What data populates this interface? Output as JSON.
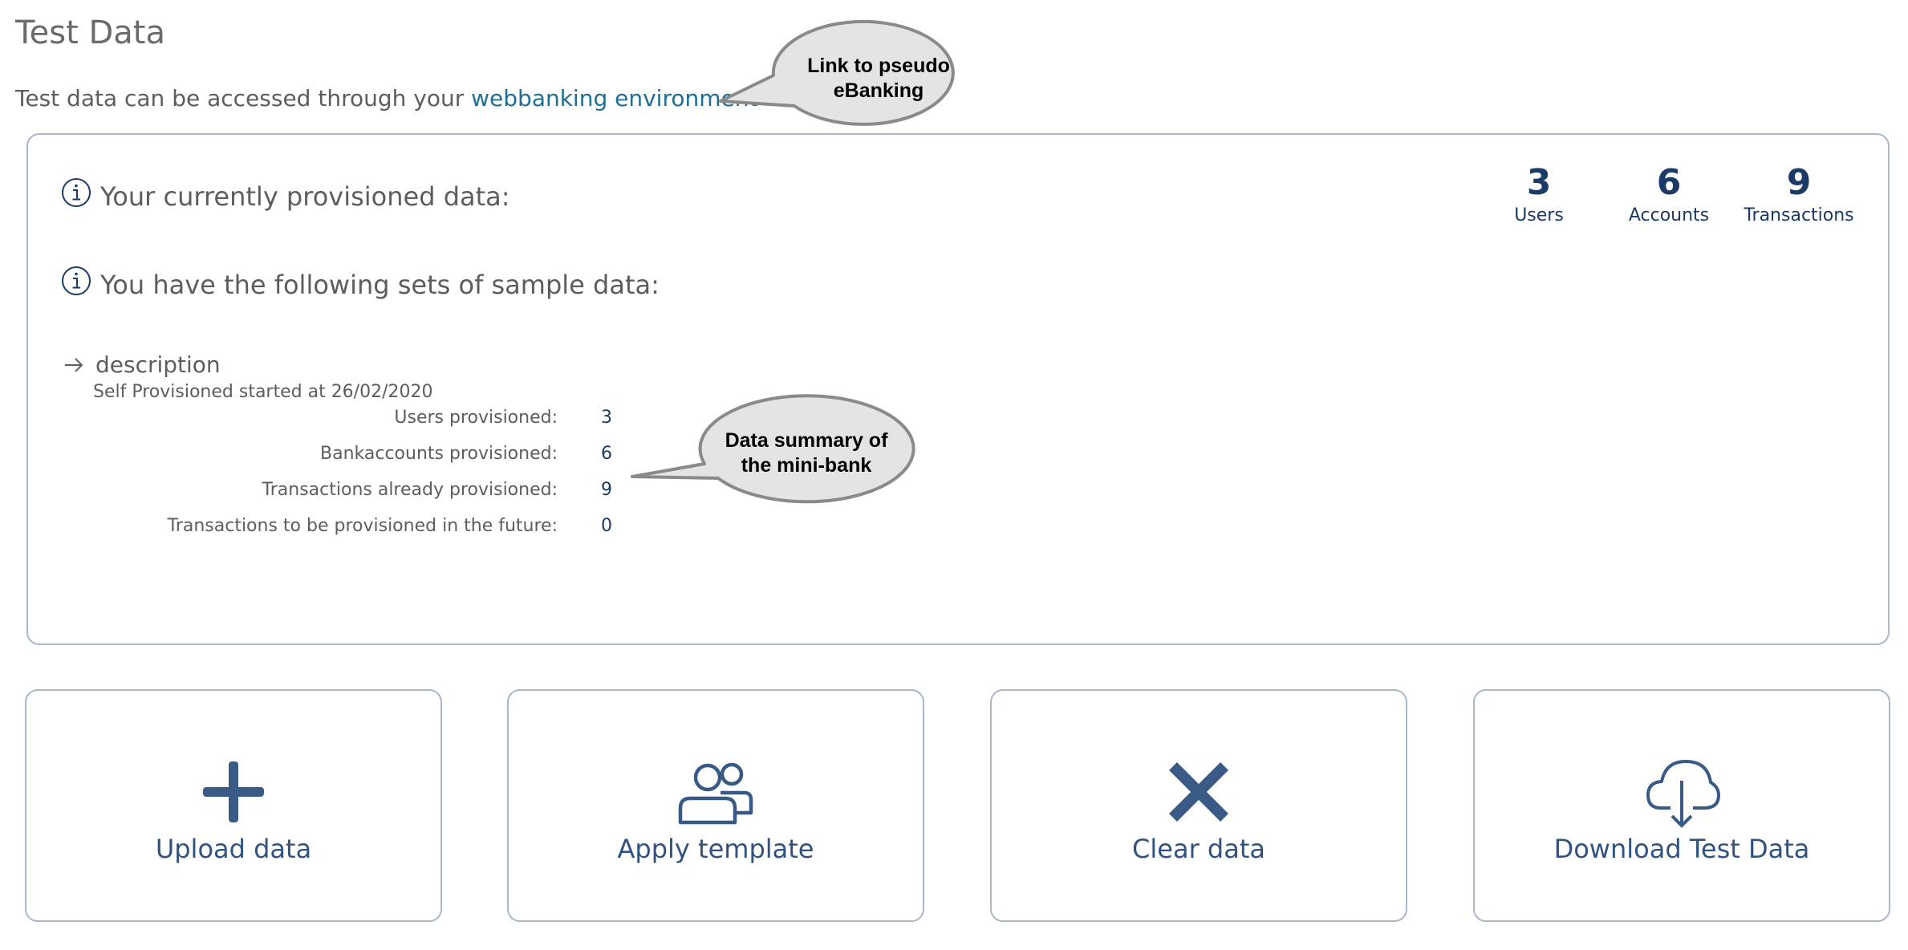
{
  "page": {
    "title": "Test Data",
    "intro_prefix": "Test data can be accessed through your ",
    "intro_link": "webbanking environment"
  },
  "panel": {
    "provisioned_heading": "Your currently provisioned data:",
    "sample_heading": "You have the following sets of sample data:",
    "stats": [
      {
        "value": "3",
        "label": "Users"
      },
      {
        "value": "6",
        "label": "Accounts"
      },
      {
        "value": "9",
        "label": "Transactions"
      }
    ],
    "dataset": {
      "name": "description",
      "started": "Self Provisioned started at 26/02/2020",
      "rows": [
        {
          "label": "Users provisioned:",
          "value": "3"
        },
        {
          "label": "Bankaccounts provisioned:",
          "value": "6"
        },
        {
          "label": "Transactions already provisioned:",
          "value": "9"
        },
        {
          "label": "Transactions to be provisioned in the future:",
          "value": "0"
        }
      ]
    }
  },
  "actions": {
    "upload": {
      "label": "Upload data",
      "icon": "plus-icon"
    },
    "template": {
      "label": "Apply template",
      "icon": "users-icon"
    },
    "clear": {
      "label": "Clear data",
      "icon": "close-icon"
    },
    "download": {
      "label": "Download Test Data",
      "icon": "cloud-download-icon"
    }
  },
  "callouts": {
    "link_note": {
      "line1": "Link to pseudo",
      "line2": "eBanking"
    },
    "summary_note": {
      "line1": "Data summary of",
      "line2": "the mini-bank"
    }
  },
  "colors": {
    "link": "#1f6e93",
    "navy": "#1c3a66",
    "action_blue": "#2f5280",
    "border": "#a9b7cb",
    "callout_fill": "#e4e4e4",
    "callout_stroke": "#8a8a8a"
  }
}
